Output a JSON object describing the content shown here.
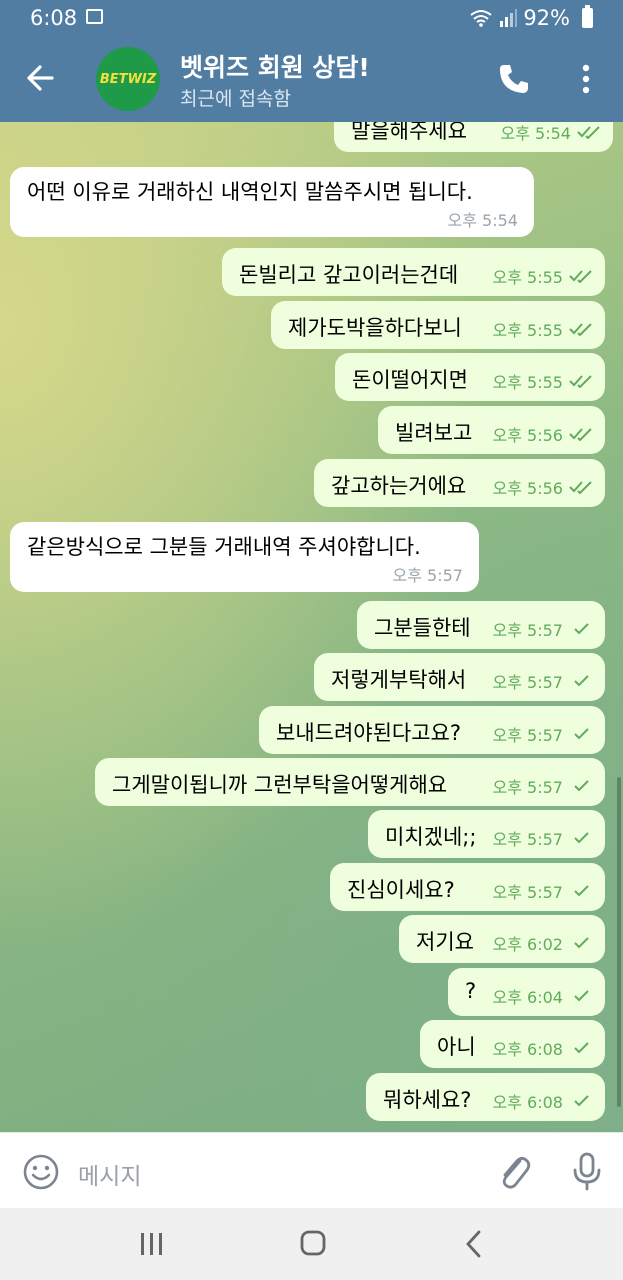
{
  "status": {
    "time": "6:08",
    "battery": "92%"
  },
  "header": {
    "title": "벳위즈 회원 상담!",
    "subtitle": "최근에 접속함",
    "avatar_text": "BETWIZ"
  },
  "messages": [
    {
      "dir": "out",
      "text": "말을해주세요",
      "time": "오후 5:54",
      "read": true
    },
    {
      "dir": "in",
      "text": "어떤 이유로 거래하신 내역인지 말씀주시면 됩니다.",
      "time": "오후 5:54"
    },
    {
      "dir": "out",
      "text": "돈빌리고 갚고이러는건데",
      "time": "오후 5:55",
      "read": true
    },
    {
      "dir": "out",
      "text": "제가도박을하다보니",
      "time": "오후 5:55",
      "read": true
    },
    {
      "dir": "out",
      "text": "돈이떨어지면",
      "time": "오후 5:55",
      "read": true
    },
    {
      "dir": "out",
      "text": "빌려보고",
      "time": "오후 5:56",
      "read": true
    },
    {
      "dir": "out",
      "text": "갚고하는거에요",
      "time": "오후 5:56",
      "read": true
    },
    {
      "dir": "in",
      "text": "같은방식으로 그분들 거래내역 주셔야합니다.",
      "time": "오후 5:57"
    },
    {
      "dir": "out",
      "text": "그분들한테",
      "time": "오후 5:57",
      "read": false
    },
    {
      "dir": "out",
      "text": "저렇게부탁해서",
      "time": "오후 5:57",
      "read": false
    },
    {
      "dir": "out",
      "text": "보내드려야된다고요?",
      "time": "오후 5:57",
      "read": false
    },
    {
      "dir": "out",
      "text": "그게말이됩니까 그런부탁을어떻게해요",
      "time": "오후 5:57",
      "read": false
    },
    {
      "dir": "out",
      "text": "미치겠네;;",
      "time": "오후 5:57",
      "read": false
    },
    {
      "dir": "out",
      "text": "진심이세요?",
      "time": "오후 5:57",
      "read": false
    },
    {
      "dir": "out",
      "text": "저기요",
      "time": "오후 6:02",
      "read": false
    },
    {
      "dir": "out",
      "text": "?",
      "time": "오후 6:04",
      "read": false
    },
    {
      "dir": "out",
      "text": "아니",
      "time": "오후 6:08",
      "read": false
    },
    {
      "dir": "out",
      "text": "뭐하세요?",
      "time": "오후 6:08",
      "read": false
    }
  ],
  "composer": {
    "placeholder": "메시지"
  },
  "icons": {
    "back": "arrow-left-icon",
    "call": "phone-icon",
    "menu": "more-vert-icon",
    "emoji": "emoji-icon",
    "attach": "paperclip-icon",
    "mic": "microphone-icon",
    "read": "double-check-icon",
    "sent": "check-icon"
  },
  "colors": {
    "header": "#527da3",
    "bubble_out": "#effedd",
    "bubble_in": "#ffffff",
    "check": "#5fac5d"
  }
}
